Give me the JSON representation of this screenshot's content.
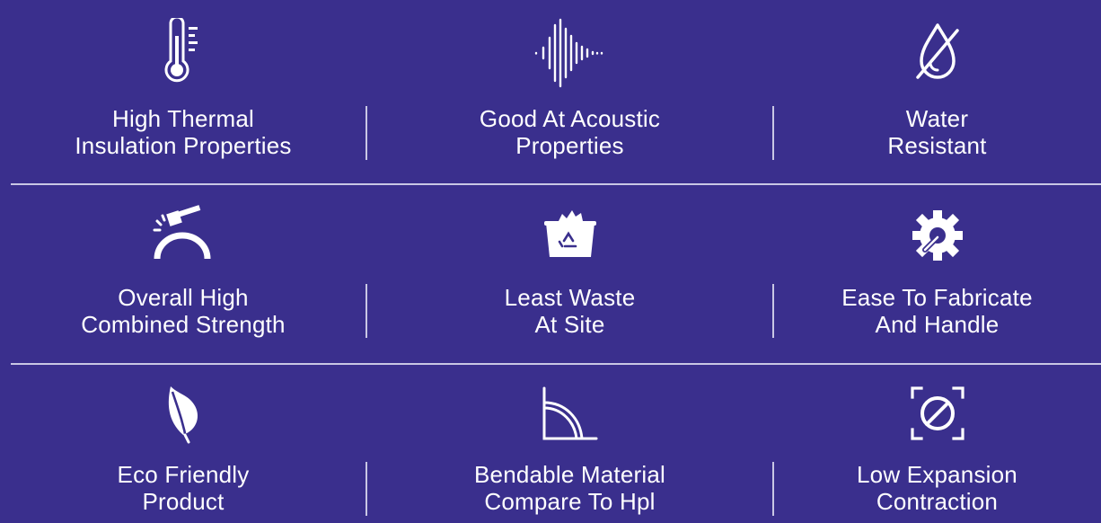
{
  "background_color": "#3a2f8d",
  "divider_color": "#c9c7e4",
  "features": [
    {
      "icon": "thermometer-icon",
      "line1": "High Thermal",
      "line2": "Insulation Properties"
    },
    {
      "icon": "sound-wave-icon",
      "line1": "Good At Acoustic",
      "line2": "Properties"
    },
    {
      "icon": "water-drop-icon",
      "line1": "Water",
      "line2": "Resistant"
    },
    {
      "icon": "hammer-strength-icon",
      "line1": "Overall High",
      "line2": "Combined Strength"
    },
    {
      "icon": "recycle-bin-icon",
      "line1": "Least Waste",
      "line2": "At Site"
    },
    {
      "icon": "gear-wrench-icon",
      "line1": "Ease To Fabricate",
      "line2": "And Handle"
    },
    {
      "icon": "leaf-icon",
      "line1": "Eco Friendly",
      "line2": "Product"
    },
    {
      "icon": "bend-curve-icon",
      "line1": "Bendable Material",
      "line2": "Compare To Hpl"
    },
    {
      "icon": "expansion-icon",
      "line1": "Low Expansion",
      "line2": "Contraction"
    }
  ]
}
